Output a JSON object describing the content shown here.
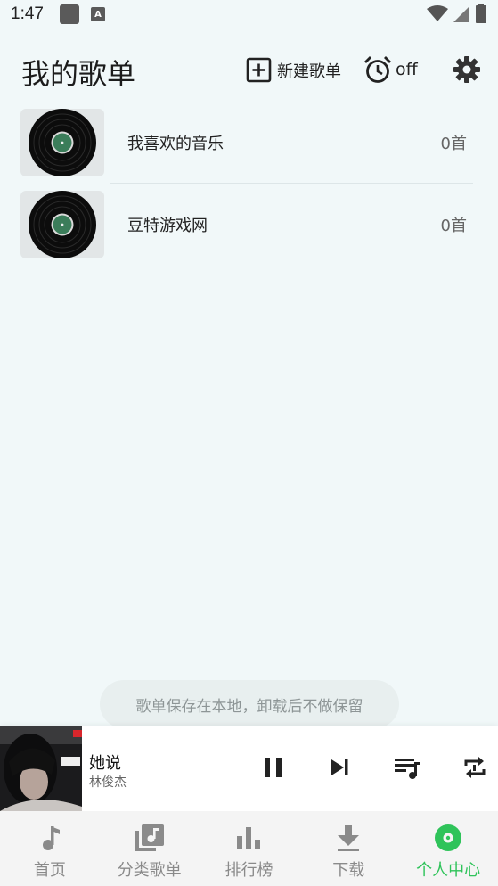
{
  "status_bar": {
    "time": "1:47",
    "a_icon": "A"
  },
  "header": {
    "title": "我的歌单",
    "new_playlist_label": "新建歌单",
    "alarm_label": "off"
  },
  "playlists": [
    {
      "name": "我喜欢的音乐",
      "count": "0首"
    },
    {
      "name": "豆特游戏网",
      "count": "0首"
    }
  ],
  "toast": {
    "text": "歌单保存在本地，卸载后不做保留"
  },
  "player": {
    "title": "她说",
    "artist": "林俊杰"
  },
  "nav": {
    "items": [
      {
        "label": "首页"
      },
      {
        "label": "分类歌单"
      },
      {
        "label": "排行榜"
      },
      {
        "label": "下载"
      },
      {
        "label": "个人中心"
      }
    ]
  },
  "colors": {
    "accent": "#2fc35a",
    "background": "#f1f8f9"
  }
}
